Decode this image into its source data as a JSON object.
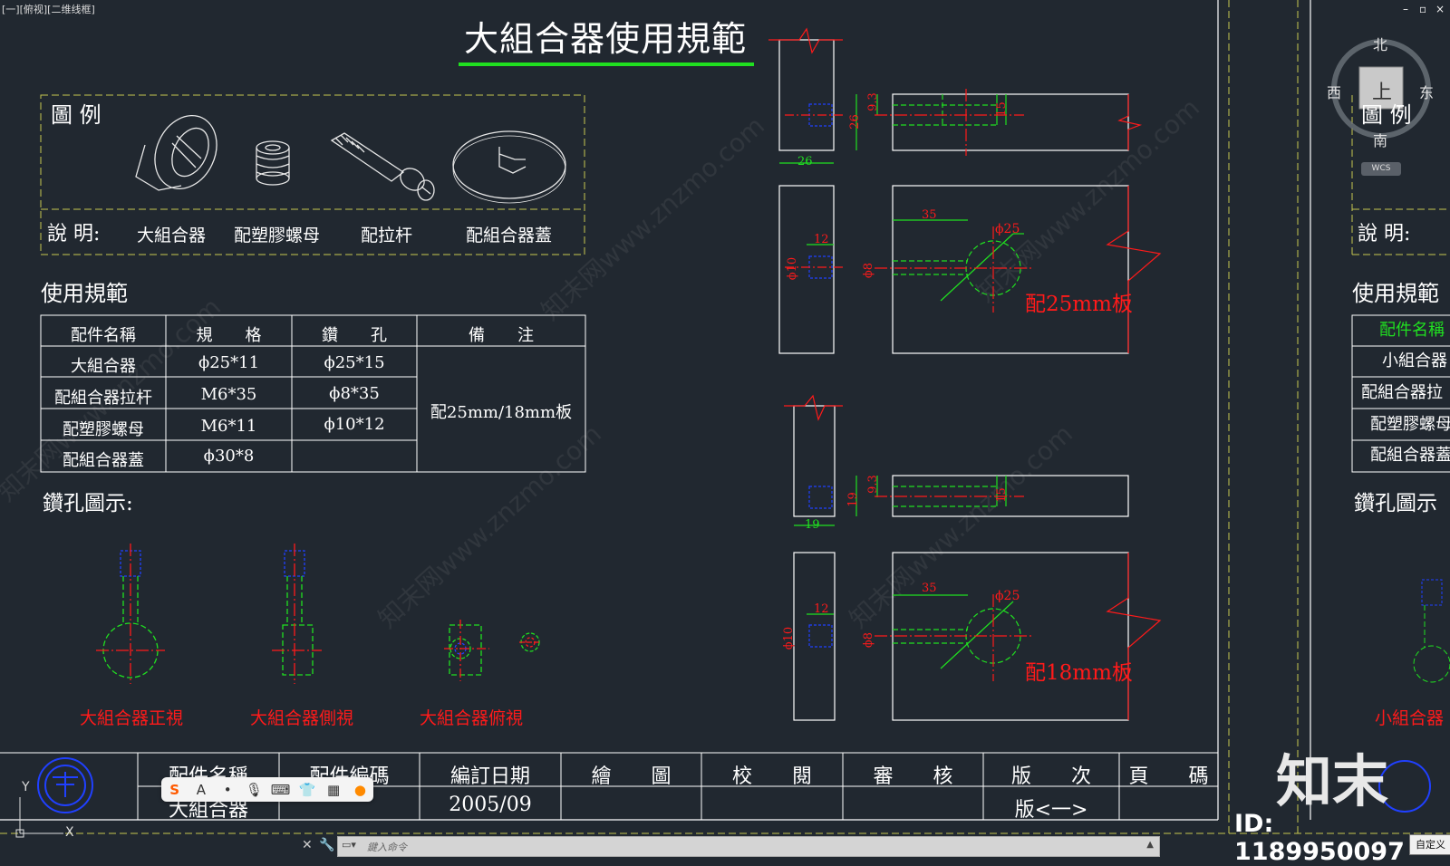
{
  "viewport": {
    "label": "[一][俯视][二维线框]"
  },
  "sheet": {
    "title": "大組合器使用規範",
    "legend": {
      "heading": "圖 例",
      "desc_label": "說 明:",
      "items": [
        "大組合器",
        "配塑膠螺母",
        "配拉杆",
        "配組合器蓋"
      ]
    },
    "usage_heading": "使用規範",
    "table": {
      "headers": [
        "配件名稱",
        "規　　格",
        "鑽　　孔",
        "備　　注"
      ],
      "rows": [
        {
          "name": "大組合器",
          "spec": "ϕ25*11",
          "drill": "ϕ25*15"
        },
        {
          "name": "配組合器拉杆",
          "spec": "M6*35",
          "drill": "ϕ8*35"
        },
        {
          "name": "配塑膠螺母",
          "spec": "M6*11",
          "drill": "ϕ10*12"
        },
        {
          "name": "配組合器蓋",
          "spec": "ϕ30*8",
          "drill": ""
        }
      ],
      "note": "配25mm/18mm板"
    },
    "drill_heading": "鑽孔圖示:",
    "views": [
      "大組合器正視",
      "大組合器側視",
      "大組合器俯視"
    ],
    "detail_25": {
      "dims": [
        "26",
        "26",
        "9.3",
        "15",
        "12",
        "35",
        "ϕ25",
        "ϕ10",
        "ϕ8"
      ],
      "label": "配25mm板"
    },
    "detail_18": {
      "dims": [
        "19",
        "19",
        "9.3",
        "15",
        "12",
        "35",
        "ϕ25",
        "ϕ10",
        "ϕ8"
      ],
      "label": "配18mm板"
    },
    "title_block": {
      "headers": [
        "配件名稱",
        "配件編碼",
        "編訂日期",
        "繪　　圖",
        "校　　閱",
        "審　　核",
        "版　　次",
        "頁　　碼"
      ],
      "values": [
        "大組合器",
        "",
        "2005/09",
        "",
        "",
        "",
        "版<一>",
        ""
      ]
    }
  },
  "right_sheet": {
    "legend_heading": "圖 例",
    "desc_label": "說 明:",
    "usage_heading": "使用規範",
    "rows": [
      "配件名稱",
      "小組合器",
      "配組合器拉",
      "配塑膠螺母",
      "配組合器蓋"
    ],
    "drill_heading": "鑽孔圖示",
    "view_label": "小組合器"
  },
  "viewcube": {
    "north": "北",
    "south": "南",
    "east": "东",
    "west": "西",
    "face": "上",
    "wcs": "WCS"
  },
  "window_controls": [
    "–",
    "▫",
    "×"
  ],
  "command_line": {
    "placeholder": "鍵入命令"
  },
  "ime_toolbar": {
    "icons": [
      "S",
      "A",
      "•",
      "mic-icon",
      "keyboard-icon",
      "shirt-icon",
      "grid-icon",
      "mascot-icon"
    ]
  },
  "custom_button": "自定义",
  "watermark": {
    "logo": "知末",
    "id": "ID: 1189950097",
    "url": "知末网www.znzmo.com"
  },
  "ucs": {
    "y": "Y",
    "x": "X"
  },
  "colors": {
    "background": "#212830",
    "green": "#20e020",
    "red": "#ff1a1a",
    "blue": "#2040ff",
    "frame": "#c8c850"
  }
}
